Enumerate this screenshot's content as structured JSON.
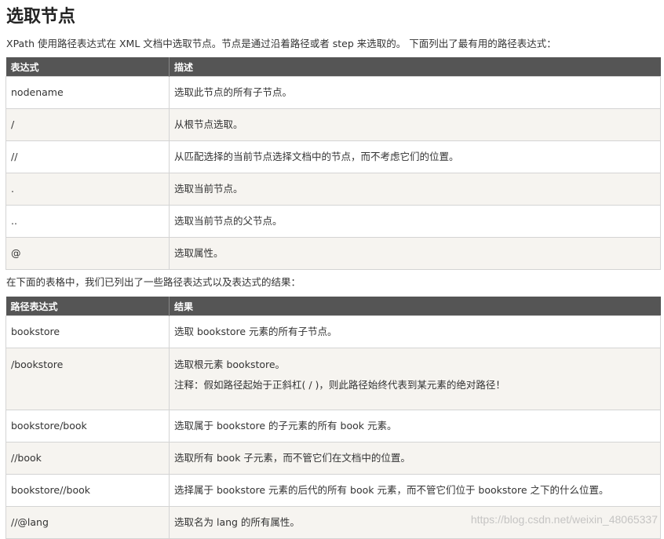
{
  "title": "选取节点",
  "intro": "XPath 使用路径表达式在 XML 文档中选取节点。节点是通过沿着路径或者 step 来选取的。 下面列出了最有用的路径表达式：",
  "table1": {
    "headers": [
      "表达式",
      "描述"
    ],
    "rows": [
      [
        "nodename",
        "选取此节点的所有子节点。"
      ],
      [
        "/",
        "从根节点选取。"
      ],
      [
        "//",
        "从匹配选择的当前节点选择文档中的节点，而不考虑它们的位置。"
      ],
      [
        ".",
        "选取当前节点。"
      ],
      [
        "..",
        "选取当前节点的父节点。"
      ],
      [
        "@",
        "选取属性。"
      ]
    ]
  },
  "intro2": "在下面的表格中，我们已列出了一些路径表达式以及表达式的结果：",
  "table2": {
    "headers": [
      "路径表达式",
      "结果"
    ],
    "rows": [
      [
        "bookstore",
        "选取 bookstore 元素的所有子节点。"
      ],
      [
        "/bookstore",
        "选取根元素 bookstore。"
      ],
      [
        "bookstore/book",
        "选取属于 bookstore 的子元素的所有 book 元素。"
      ],
      [
        "//book",
        "选取所有 book 子元素，而不管它们在文档中的位置。"
      ],
      [
        "bookstore//book",
        "选择属于 bookstore 元素的后代的所有 book 元素，而不管它们位于 bookstore 之下的什么位置。"
      ],
      [
        "//@lang",
        "选取名为 lang 的所有属性。"
      ]
    ],
    "note": "注释：假如路径起始于正斜杠( / )，则此路径始终代表到某元素的绝对路径！"
  },
  "watermark": "https://blog.csdn.net/weixin_48065337"
}
